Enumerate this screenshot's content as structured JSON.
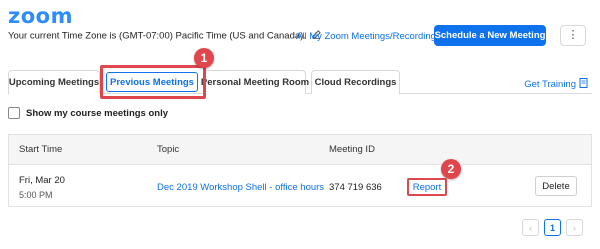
{
  "app": {
    "logo": "zoom"
  },
  "header": {
    "timezone_text": "Your current Time Zone is (GMT-07:00) Pacific Time (US and Canada).",
    "all_link": "All My Zoom Meetings/Recordings",
    "schedule_button": "Schedule a New Meeting",
    "more_button": "⋮"
  },
  "tabs": [
    {
      "label": "Upcoming Meetings",
      "active": false
    },
    {
      "label": "Previous Meetings",
      "active": true
    },
    {
      "label": "Personal Meeting Room",
      "active": false
    },
    {
      "label": "Cloud Recordings",
      "active": false
    }
  ],
  "get_training": "Get Training",
  "filter": {
    "label": "Show my course meetings only",
    "checked": false
  },
  "table": {
    "columns": [
      "Start Time",
      "Topic",
      "Meeting ID"
    ],
    "rows": [
      {
        "date": "Fri, Mar 20",
        "time": "5:00 PM",
        "topic": "Dec 2019 Workshop Shell - office hours",
        "meeting_id": "374 719 636",
        "report": "Report",
        "delete": "Delete"
      }
    ]
  },
  "pagination": {
    "prev": "‹",
    "current": "1",
    "next": "›"
  },
  "callouts": {
    "step1": "1",
    "step2": "2"
  },
  "colors": {
    "brand": "#2d8cff",
    "link": "#0e72ed",
    "highlight": "#e0474c"
  }
}
